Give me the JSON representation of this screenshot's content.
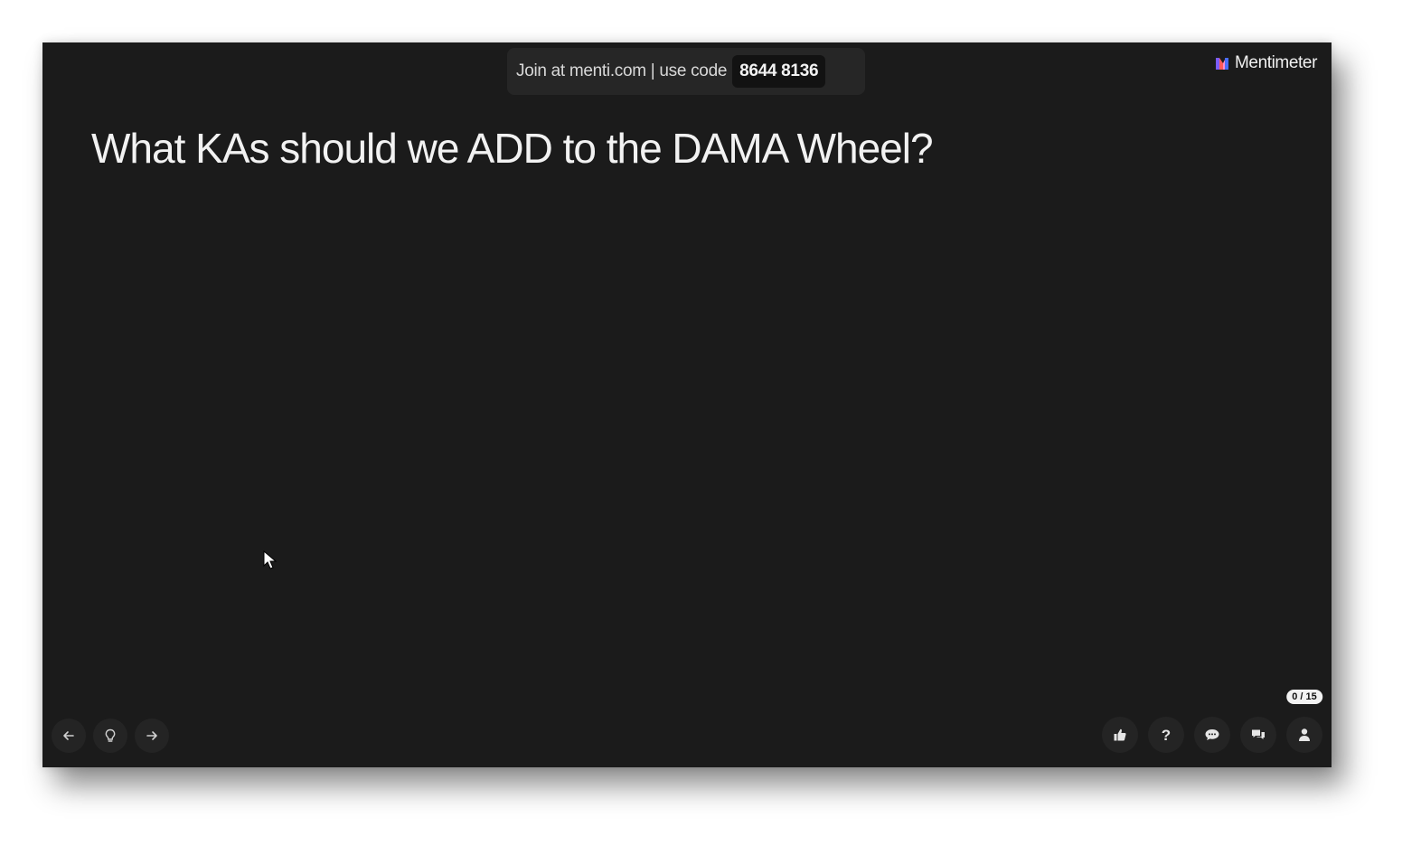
{
  "join_bar": {
    "text": "Join at menti.com | use code",
    "code": "8644 8136"
  },
  "brand": {
    "name": "Mentimeter",
    "logo_colors": [
      "#7b5cff",
      "#ff5a5a",
      "#4a6cff"
    ]
  },
  "slide": {
    "title": "What KAs should we ADD to the DAMA Wheel?"
  },
  "nav_left": [
    {
      "icon": "arrow-left-icon"
    },
    {
      "icon": "lightbulb-icon"
    },
    {
      "icon": "arrow-right-icon"
    }
  ],
  "nav_right": [
    {
      "icon": "thumbs-up-icon"
    },
    {
      "icon": "question-icon",
      "glyph": "?"
    },
    {
      "icon": "chat-icon"
    },
    {
      "icon": "comments-icon"
    },
    {
      "icon": "audience-icon"
    }
  ],
  "audience": {
    "count": "0 / 15"
  },
  "colors": {
    "slide_background": "#1b1b1b",
    "text": "#f2f2f2",
    "button_background": "#242424"
  }
}
